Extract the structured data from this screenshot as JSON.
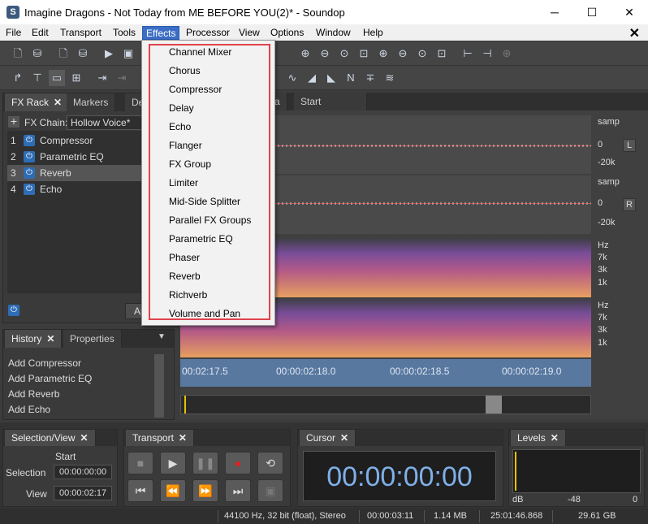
{
  "window": {
    "title": "Imagine Dragons - Not Today from ME BEFORE YOU(2)* - Soundop",
    "minimize": "─",
    "maximize": "☐",
    "close": "✕"
  },
  "menubar": {
    "items": [
      "File",
      "Edit",
      "Transport",
      "Tools",
      "Effects",
      "Processor",
      "View",
      "Options",
      "Window",
      "Help"
    ],
    "mdi_close": "✕"
  },
  "effects_menu": {
    "items": [
      "Channel Mixer",
      "Chorus",
      "Compressor",
      "Delay",
      "Echo",
      "Flanger",
      "FX Group",
      "Limiter",
      "Mid-Side Splitter",
      "Parallel FX Groups",
      "Parametric EQ",
      "Phaser",
      "Reverb",
      "Richverb",
      "Volume and Pan"
    ]
  },
  "left_tabs": {
    "fx_rack": "FX Rack",
    "markers": "Markers",
    "de": "De"
  },
  "fx_rack": {
    "chain_label": "FX Chain:",
    "chain_value": "Hollow Voice*",
    "apply": "Ap",
    "rows": [
      {
        "num": "1",
        "name": "Compressor"
      },
      {
        "num": "2",
        "name": "Parametric EQ"
      },
      {
        "num": "3",
        "name": "Reverb"
      },
      {
        "num": "4",
        "name": "Echo"
      }
    ]
  },
  "history_tabs": {
    "history": "History",
    "properties": "Properties"
  },
  "history": {
    "items": [
      "Add Compressor",
      "Add Parametric EQ",
      "Add Reverb",
      "Add Echo"
    ]
  },
  "editor_tabs": {
    "a": "a",
    "start": "Start"
  },
  "waveform": {
    "unit": "samp",
    "zero": "0",
    "neg": "-20k",
    "left_btn": "L",
    "right_btn": "R"
  },
  "spectrum": {
    "hz": "Hz",
    "t7k": "7k",
    "t3k": "3k",
    "t1k": "1k"
  },
  "timeline": {
    "labels": [
      "00:02:17.5",
      "00:00:02:18.0",
      "00:00:02:18.5",
      "00:00:02:19.0"
    ]
  },
  "selection_panel": {
    "tab": "Selection/View",
    "start_label": "Start",
    "selection_label": "Selection",
    "selection_value": "00:00:00:00",
    "view_label": "View",
    "view_value": "00:00:02:17"
  },
  "transport_panel": {
    "tab": "Transport"
  },
  "cursor_panel": {
    "tab": "Cursor",
    "time": "00:00:00:00"
  },
  "levels_panel": {
    "tab": "Levels",
    "scale": [
      "dB",
      "-48",
      "0"
    ]
  },
  "statusbar": {
    "format": "44100 Hz, 32 bit (float), Stereo",
    "length": "00:00:03:11",
    "size": "1.14 MB",
    "time": "25:01:46.868",
    "free": "29.61 GB"
  },
  "colors": {
    "accent": "#3c6ec6",
    "highlight_border": "#e0434b",
    "wave_bg": "#4a4a4a",
    "spectrum_top": "#7a4d9a",
    "spectrum_bottom": "#e8a060"
  }
}
